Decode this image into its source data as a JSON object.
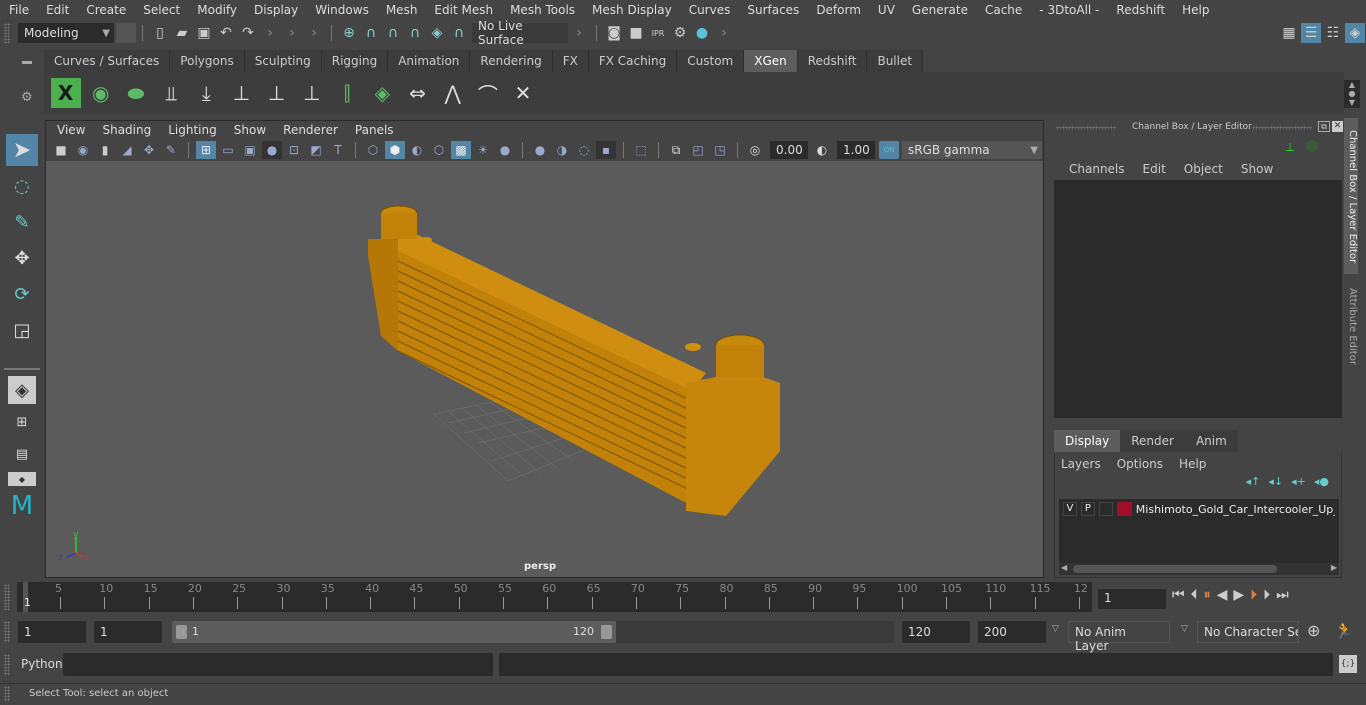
{
  "menu": [
    "File",
    "Edit",
    "Create",
    "Select",
    "Modify",
    "Display",
    "Windows",
    "Mesh",
    "Edit Mesh",
    "Mesh Tools",
    "Mesh Display",
    "Curves",
    "Surfaces",
    "Deform",
    "UV",
    "Generate",
    "Cache",
    "- 3DtoAll -",
    "Redshift",
    "Help"
  ],
  "status_line": {
    "mode_dropdown": "Modeling",
    "live_surface": "No Live Surface",
    "icons": [
      "new-scene-icon",
      "open-scene-icon",
      "save-scene-icon",
      "undo-icon",
      "redo-icon",
      "snap-grid-icon",
      "snap-curve-icon",
      "snap-point-icon",
      "snap-projected-center-icon",
      "snap-view-plane-icon",
      "make-live-icon",
      "render-current-frame-icon",
      "render-view-icon",
      "ipr-render-icon",
      "render-settings-icon",
      "hypershade-icon"
    ],
    "right_icons": [
      "modeling-toolkit-icon",
      "channel-box-toggle-icon",
      "attribute-editor-toggle-icon",
      "layer-editor-toggle-icon"
    ]
  },
  "shelf": {
    "tabs": [
      "Curves / Surfaces",
      "Polygons",
      "Sculpting",
      "Rigging",
      "Animation",
      "Rendering",
      "FX",
      "FX Caching",
      "Custom",
      "XGen",
      "Redshift",
      "Bullet"
    ],
    "active_tab": "XGen",
    "icons": [
      "xgen-editor-icon",
      "xgen-preview-icon",
      "xgen-clear-preview-icon",
      "xgen-create-description-icon",
      "xgen-place-guides-icon",
      "xgen-add-guide-icon",
      "xgen-select-guide-icon",
      "xgen-lock-guide-icon",
      "xgen-sculpt-guides-icon",
      "xgen-density-icon",
      "xgen-length-icon",
      "xgen-cut-icon",
      "xgen-bend-icon",
      "xgen-delete-guide-icon"
    ]
  },
  "toolbox": [
    "select-tool-icon",
    "lasso-tool-icon",
    "paint-select-tool-icon",
    "move-tool-icon",
    "rotate-tool-icon",
    "scale-tool-icon",
    "single-perspective-layout-icon",
    "four-view-layout-icon",
    "outliner-layout-icon",
    "persp-graph-layout-icon",
    "maya-logo-icon"
  ],
  "viewport": {
    "menu": [
      "View",
      "Shading",
      "Lighting",
      "Show",
      "Renderer",
      "Panels"
    ],
    "exposure": "0.00",
    "gamma": "1.00",
    "color_mgmt_badge": "ON",
    "color_space": "sRGB gamma",
    "camera_label": "persp",
    "axis": {
      "x": "x",
      "y": "y",
      "z": "z"
    },
    "model_color": "#c8860a",
    "bg_color": "#5b5b5b"
  },
  "channel_box": {
    "title": "Channel Box / Layer Editor",
    "menu": [
      "Channels",
      "Edit",
      "Object",
      "Show"
    ]
  },
  "layer_editor": {
    "tabs": [
      "Display",
      "Render",
      "Anim"
    ],
    "active_tab": "Display",
    "menu": [
      "Layers",
      "Options",
      "Help"
    ],
    "layers": [
      {
        "v": "V",
        "p": "P",
        "color": "#a0102a",
        "name": "Mishimoto_Gold_Car_Intercooler_Up_Si"
      }
    ]
  },
  "side_tabs": [
    "Channel Box / Layer Editor",
    "Attribute Editor"
  ],
  "timeline": {
    "ticks": [
      "5",
      "10",
      "15",
      "20",
      "25",
      "30",
      "35",
      "40",
      "45",
      "50",
      "55",
      "60",
      "65",
      "70",
      "75",
      "80",
      "85",
      "90",
      "95",
      "100",
      "105",
      "110",
      "115",
      "12"
    ],
    "current_frame_marker": "1",
    "current_frame": "1"
  },
  "range": {
    "start": "1",
    "playback_start": "1",
    "slider_start": "1",
    "slider_end": "120",
    "playback_end": "120",
    "end": "200",
    "anim_layer": "No Anim Layer",
    "character_set": "No Character Set"
  },
  "command_line": {
    "label": "Python",
    "value": ""
  },
  "help_line": "Select Tool: select an object"
}
